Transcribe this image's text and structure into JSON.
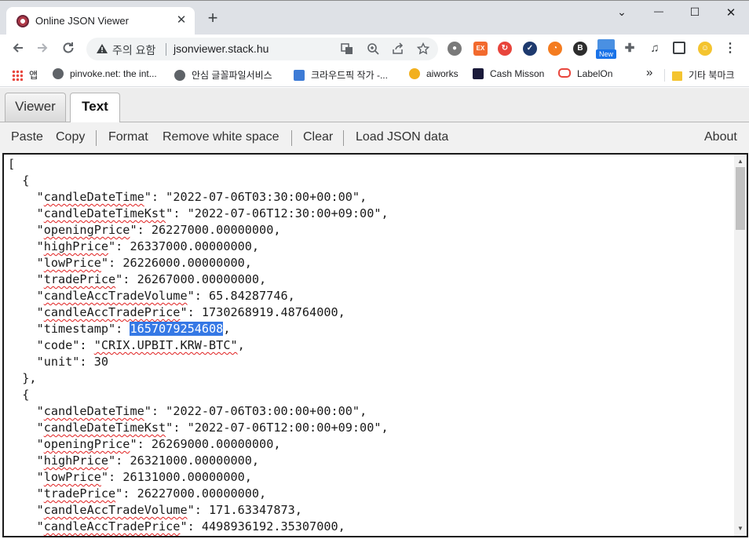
{
  "browser": {
    "tab_title": "Online JSON Viewer",
    "tab_close": "✕",
    "new_tab": "+",
    "window": {
      "minimize": "—",
      "maximize": "☐",
      "close": "✕",
      "menu": "⌄"
    },
    "security_label": "주의 요함",
    "url": "jsonviewer.stack.hu",
    "new_badge": "New",
    "bookmarks": [
      {
        "label": "앱",
        "color": "#e8453c"
      },
      {
        "label": "pinvoke.net: the int...",
        "color": "#5f6368"
      },
      {
        "label": "안심 글꼴파일서비스",
        "color": "#5f6368"
      },
      {
        "label": "크라우드픽 작가 -...",
        "color": "#3d7bd6"
      },
      {
        "label": "aiworks",
        "color": "#f2b01e"
      },
      {
        "label": "Cash Misson",
        "color": "#1a1a3a"
      },
      {
        "label": "LabelOn",
        "color": "#e8453c"
      }
    ],
    "bookmarks_more": "»",
    "other_bookmarks": "기타 북마크"
  },
  "app": {
    "tabs": [
      "Viewer",
      "Text"
    ],
    "active_tab": "Text",
    "menu": [
      "Paste",
      "Copy",
      "Format",
      "Remove white space",
      "Clear",
      "Load JSON data"
    ],
    "about": "About"
  },
  "json_text": {
    "open_bracket": "[",
    "records": [
      {
        "candleDateTime": "\"2022-07-06T03:30:00+00:00\"",
        "candleDateTimeKst": "\"2022-07-06T12:30:00+09:00\"",
        "openingPrice": "26227000.00000000",
        "highPrice": "26337000.00000000",
        "lowPrice": "26226000.00000000",
        "tradePrice": "26267000.00000000",
        "candleAccTradeVolume": "65.84287746",
        "candleAccTradePrice": "1730268919.48764000",
        "timestamp": "1657079254608",
        "code": "\"CRIX.UPBIT.KRW-BTC\"",
        "unit": "30"
      },
      {
        "candleDateTime": "\"2022-07-06T03:00:00+00:00\"",
        "candleDateTimeKst": "\"2022-07-06T12:00:00+09:00\"",
        "openingPrice": "26269000.00000000",
        "highPrice": "26321000.00000000",
        "lowPrice": "26131000.00000000",
        "tradePrice": "26227000.00000000",
        "candleAccTradeVolume": "171.63347873",
        "candleAccTradePrice": "4498936192.35307000"
      }
    ]
  },
  "colors": {
    "selection": "#3578e5",
    "spellcheck": "#e02020",
    "editor_border": "#1a1a1a"
  }
}
